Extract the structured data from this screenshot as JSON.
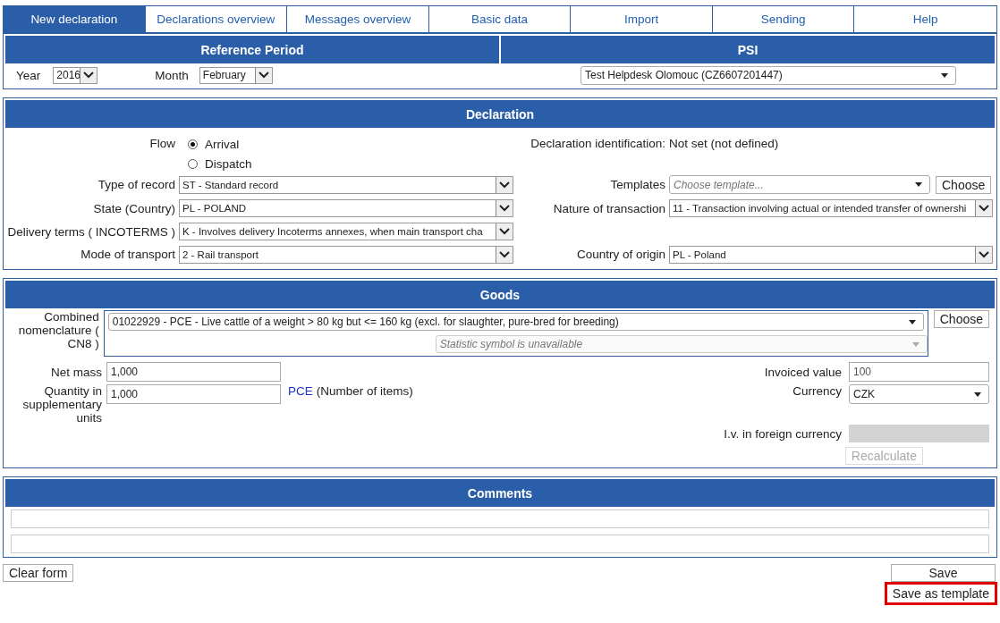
{
  "tabs": [
    {
      "label": "New declaration",
      "selected": true
    },
    {
      "label": "Declarations overview",
      "selected": false
    },
    {
      "label": "Messages overview",
      "selected": false
    },
    {
      "label": "Basic data",
      "selected": false
    },
    {
      "label": "Import",
      "selected": false
    },
    {
      "label": "Sending",
      "selected": false
    },
    {
      "label": "Help",
      "selected": false
    }
  ],
  "reference": {
    "period_title": "Reference Period",
    "psi_title": "PSI",
    "year_label": "Year",
    "year_value": "2016",
    "month_label": "Month",
    "month_value": "February",
    "psi_value": "Test Helpdesk Olomouc (CZ6607201447)"
  },
  "declaration": {
    "title": "Declaration",
    "flow": {
      "label": "Flow",
      "options": [
        {
          "label": "Arrival",
          "selected": true
        },
        {
          "label": "Dispatch",
          "selected": false
        }
      ]
    },
    "identification": {
      "label": "Declaration identification:",
      "value": "Not set (not defined)"
    },
    "type_of_record": {
      "label": "Type of record",
      "value": "ST - Standard record"
    },
    "templates": {
      "label": "Templates",
      "placeholder": "Choose template...",
      "button": "Choose"
    },
    "state": {
      "label": "State (Country)",
      "value": "PL - POLAND"
    },
    "nature": {
      "label": "Nature of transaction",
      "value": "11 - Transaction involving actual or intended transfer of ownershi"
    },
    "delivery_terms": {
      "label": "Delivery terms ( INCOTERMS )",
      "value": "K - Involves delivery Incoterms annexes, when main transport cha"
    },
    "mode_of_transport": {
      "label": "Mode of transport",
      "value": "2 - Rail transport"
    },
    "country_of_origin": {
      "label": "Country of origin",
      "value": "PL - Poland"
    }
  },
  "goods": {
    "title": "Goods",
    "cn8": {
      "label": "Combined nomenclature ( CN8 )",
      "value": "01022929 - PCE - Live cattle of a weight > 80 kg but <= 160 kg (excl. for slaughter, pure-bred for breeding)",
      "button": "Choose"
    },
    "statistic_symbol": {
      "placeholder": "Statistic symbol is unavailable",
      "disabled": true
    },
    "net_mass": {
      "label": "Net mass",
      "value": "1,000"
    },
    "quantity": {
      "label": "Quantity in supplementary units",
      "value": "1,000",
      "unit": "PCE",
      "unit_note": "(Number of items)"
    },
    "invoiced_value": {
      "label": "Invoiced value",
      "value": "100"
    },
    "currency": {
      "label": "Currency",
      "value": "CZK"
    },
    "foreign_value": {
      "label": "I.v. in foreign currency",
      "disabled": true
    },
    "recalculate": {
      "label": "Recalculate",
      "disabled": true
    }
  },
  "comments": {
    "title": "Comments"
  },
  "buttons": {
    "clear": {
      "label": "Clear form"
    },
    "save": {
      "label": "Save"
    },
    "save_template": {
      "label": "Save as template",
      "highlighted": true
    }
  }
}
